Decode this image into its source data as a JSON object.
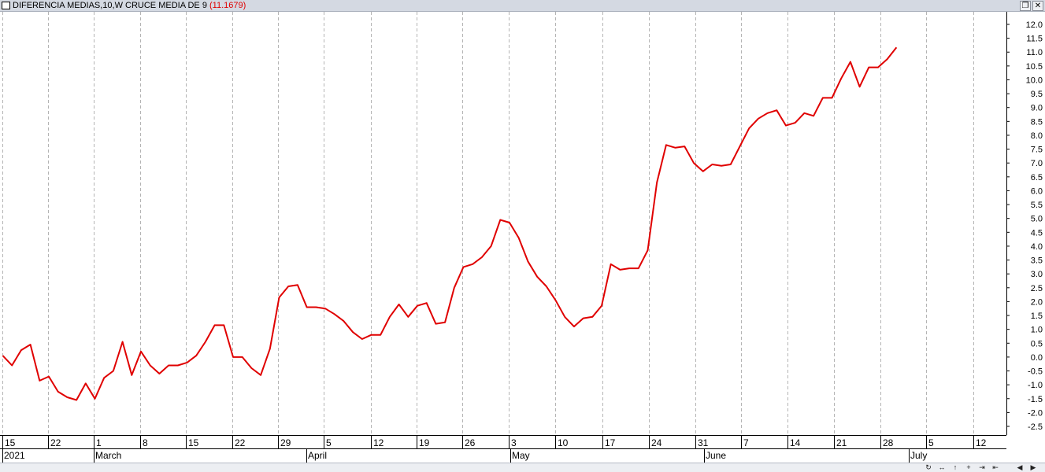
{
  "window": {
    "title": "DIFERENCIA  MEDIAS,10,W CRUCE MEDIA DE 9",
    "current_value": "(11.1679)",
    "restore_icon": "restore-window-icon",
    "close_icon": "close-window-icon"
  },
  "colors": {
    "series": "#e00000",
    "grid": "#b4b4b4",
    "axis": "#000000"
  },
  "chart_data": {
    "type": "line",
    "title": "DIFERENCIA  MEDIAS,10,W CRUCE MEDIA DE 9",
    "series": [
      {
        "values": [
          0.05,
          -0.3,
          0.25,
          0.45,
          -0.85,
          -0.7,
          -1.25,
          -1.45,
          -1.55,
          -0.95,
          -1.5,
          -0.75,
          -0.5,
          0.55,
          -0.65,
          0.2,
          -0.3,
          -0.6,
          -0.3,
          -0.3,
          -0.2,
          0.05,
          0.55,
          1.15,
          1.15,
          0.0,
          0.0,
          -0.4,
          -0.65,
          0.3,
          2.15,
          2.55,
          2.6,
          1.8,
          1.8,
          1.75,
          1.55,
          1.3,
          0.9,
          0.65,
          0.8,
          0.8,
          1.45,
          1.9,
          1.45,
          1.85,
          1.95,
          1.2,
          1.25,
          2.5,
          3.25,
          3.35,
          3.6,
          4.0,
          4.95,
          4.85,
          4.3,
          3.45,
          2.9,
          2.55,
          2.05,
          1.45,
          1.1,
          1.4,
          1.45,
          1.85,
          3.35,
          3.15,
          3.2,
          3.2,
          3.85,
          6.3,
          7.65,
          7.55,
          7.6,
          7.0,
          6.7,
          6.95,
          6.9,
          6.95,
          7.6,
          8.25,
          8.6,
          8.8,
          8.9,
          8.35,
          8.45,
          8.8,
          8.7,
          9.35,
          9.35,
          10.05,
          10.65,
          9.75,
          10.45,
          10.45,
          10.75,
          11.1679
        ]
      }
    ],
    "x_tick_labels": [
      "15",
      "22",
      "1",
      "8",
      "15",
      "22",
      "29",
      "5",
      "12",
      "19",
      "26",
      "3",
      "10",
      "17",
      "24",
      "31",
      "7",
      "14",
      "21",
      "28",
      "5",
      "12"
    ],
    "month_labels": [
      "2021",
      "March",
      "April",
      "May",
      "June",
      "July"
    ],
    "ylim": [
      -2.8,
      12.3
    ],
    "y_ticks": [
      "12.0",
      "11.5",
      "11.0",
      "10.5",
      "10.0",
      "9.5",
      "9.0",
      "8.5",
      "8.0",
      "7.5",
      "7.0",
      "6.5",
      "6.0",
      "5.5",
      "5.0",
      "4.5",
      "4.0",
      "3.5",
      "3.0",
      "2.5",
      "2.0",
      "1.5",
      "1.0",
      "0.5",
      "0.0",
      "-0.5",
      "-1.0",
      "-1.5",
      "-2.0",
      "-2.5"
    ],
    "y_tick_values": [
      12,
      11.5,
      11,
      10.5,
      10,
      9.5,
      9,
      8.5,
      8,
      7.5,
      7,
      6.5,
      6,
      5.5,
      5,
      4.5,
      4,
      3.5,
      3,
      2.5,
      2,
      1.5,
      1,
      0.5,
      0,
      -0.5,
      -1,
      -1.5,
      -2,
      -2.5
    ],
    "grid": "vertical dashed",
    "y_axis_position": "right"
  }
}
